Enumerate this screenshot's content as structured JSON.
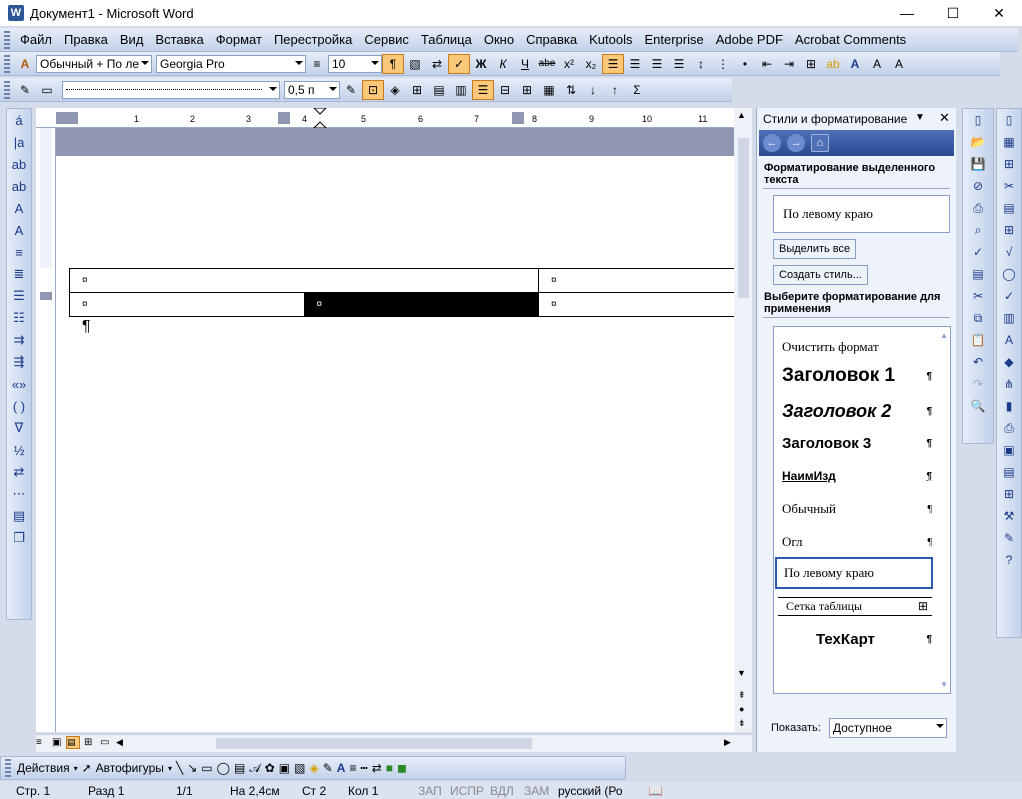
{
  "window": {
    "title": "Документ1 - Microsoft Word",
    "app_icon": "W"
  },
  "menu": [
    "Файл",
    "Правка",
    "Вид",
    "Вставка",
    "Формат",
    "Перестройка",
    "Сервис",
    "Таблица",
    "Окно",
    "Справка",
    "Kutools",
    "Enterprise",
    "Adobe PDF",
    "Acrobat Comments"
  ],
  "formatting": {
    "style": "Обычный + По ле",
    "font": "Georgia Pro",
    "size": "10",
    "bold": "Ж",
    "italic": "К",
    "underline": "Ч",
    "strike": "abe",
    "superscript": "x²",
    "subscript": "x₂"
  },
  "tables_toolbar": {
    "line_width": "0,5 п",
    "sum": "Σ"
  },
  "left_toolbar": [
    "á",
    "|a",
    "ab",
    "ab",
    "A",
    "A",
    "«»",
    "( )",
    "∇",
    "½"
  ],
  "ruler": [
    "1",
    "2",
    "3",
    "4",
    "5",
    "6",
    "7",
    "8",
    "9",
    "10",
    "11"
  ],
  "document": {
    "cell_mark": "¤",
    "para_mark": "¶"
  },
  "task_pane": {
    "title": "Стили и форматирование",
    "section1": "Форматирование выделенного текста",
    "current": "По левому краю",
    "select_all": "Выделить все",
    "new_style": "Создать стиль...",
    "section2": "Выберите форматирование для применения",
    "styles": [
      {
        "name": "Очистить формат",
        "mark": ""
      },
      {
        "name": "Заголовок 1",
        "mark": "¶"
      },
      {
        "name": "Заголовок 2",
        "mark": "¶"
      },
      {
        "name": "Заголовок 3",
        "mark": "¶"
      },
      {
        "name": "НаимИзд",
        "mark": "¶"
      },
      {
        "name": "Обычный",
        "mark": "¶"
      },
      {
        "name": "Огл",
        "mark": "¶"
      },
      {
        "name": "По левому краю",
        "mark": ""
      },
      {
        "name": "Сетка таблицы",
        "mark": "⊞"
      },
      {
        "name": "ТехКарт",
        "mark": "¶"
      }
    ],
    "show_label": "Показать:",
    "show_value": "Доступное"
  },
  "drawing": {
    "actions": "Действия",
    "autoshapes": "Автофигуры"
  },
  "status": {
    "page": "Стр. 1",
    "section": "Разд 1",
    "pages": "1/1",
    "at": "На 2,4см",
    "line": "Ст 2",
    "col": "Кол 1",
    "rec": "ЗАП",
    "trk": "ИСПР",
    "ext": "ВДЛ",
    "ovr": "ЗАМ",
    "lang": "русский (Ро"
  },
  "colors": {
    "accent": "#2a4a94",
    "toolbar": "#c2d1ea",
    "header_band": "#8f98b0"
  }
}
